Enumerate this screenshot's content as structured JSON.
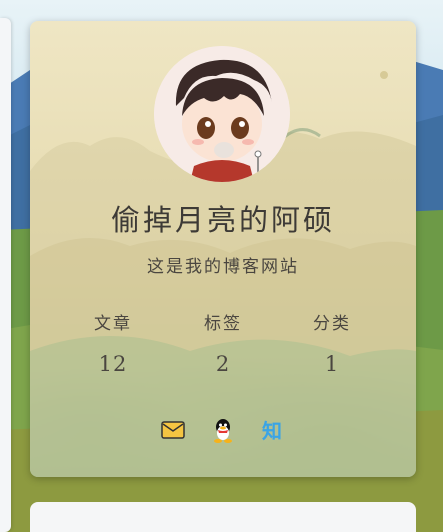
{
  "profile": {
    "title": "偷掉月亮的阿硕",
    "subtitle": "这是我的博客网站"
  },
  "stats": [
    {
      "label": "文章",
      "value": "12"
    },
    {
      "label": "标签",
      "value": "2"
    },
    {
      "label": "分类",
      "value": "1"
    }
  ],
  "social": {
    "mail_icon": "mail-icon",
    "qq_icon": "qq-icon",
    "zhihu_text": "知"
  },
  "colors": {
    "title_text": "#3d3a36",
    "zhihu_blue": "#3aa4e6",
    "card_bottom_green": "#4f9677"
  }
}
